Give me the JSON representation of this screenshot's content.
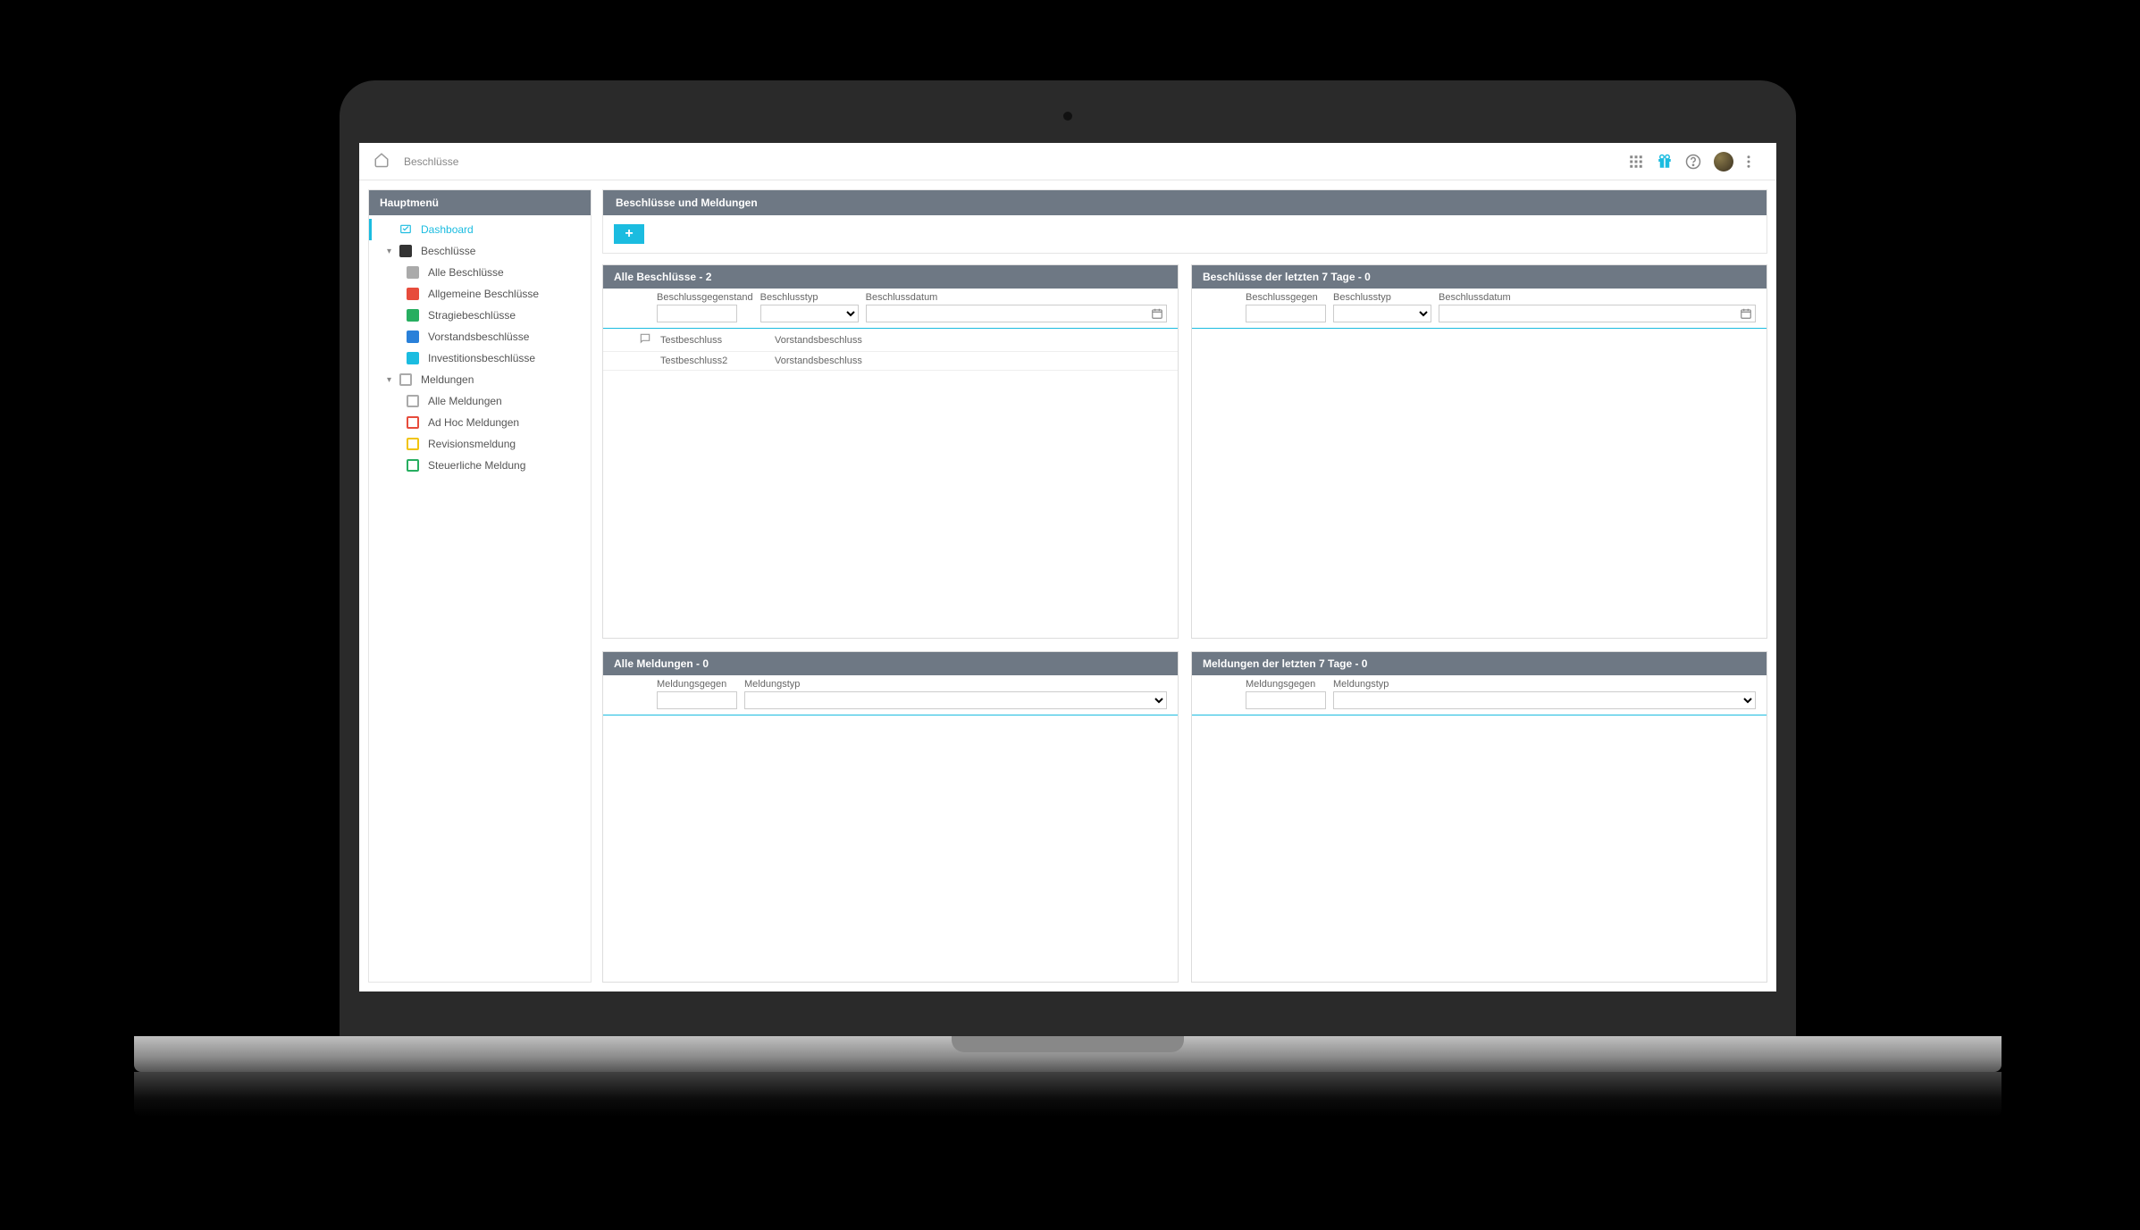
{
  "breadcrumb": "Beschlüsse",
  "sidebar": {
    "header": "Hauptmenü",
    "dashboard": "Dashboard",
    "beschluesse": {
      "label": "Beschlüsse",
      "alle": "Alle Beschlüsse",
      "allgemeine": "Allgemeine Beschlüsse",
      "strategie": "Stragiebeschlüsse",
      "vorstand": "Vorstandsbeschlüsse",
      "investition": "Investitionsbeschlüsse"
    },
    "meldungen": {
      "label": "Meldungen",
      "alle": "Alle Meldungen",
      "adhoc": "Ad Hoc Meldungen",
      "revision": "Revisionsmeldung",
      "steuer": "Steuerliche Meldung"
    }
  },
  "main_header": "Beschlüsse und Meldungen",
  "cards": {
    "c1": {
      "title": "Alle Beschlüsse - 2",
      "cols": {
        "a": "Beschlussgegenstand",
        "b": "Beschlusstyp",
        "c": "Beschlussdatum"
      },
      "rows": [
        {
          "a": "Testbeschluss",
          "b": "Vorstandsbeschluss",
          "c": ""
        },
        {
          "a": "Testbeschluss2",
          "b": "Vorstandsbeschluss",
          "c": ""
        }
      ]
    },
    "c2": {
      "title": "Beschlüsse der letzten 7 Tage - 0",
      "cols": {
        "a": "Beschlussgegen",
        "b": "Beschlusstyp",
        "c": "Beschlussdatum"
      }
    },
    "c3": {
      "title": "Alle Meldungen - 0",
      "cols": {
        "a": "Meldungsgegen",
        "b": "Meldungstyp"
      }
    },
    "c4": {
      "title": "Meldungen der letzten 7 Tage - 0",
      "cols": {
        "a": "Meldungsgegen",
        "b": "Meldungstyp"
      }
    }
  }
}
